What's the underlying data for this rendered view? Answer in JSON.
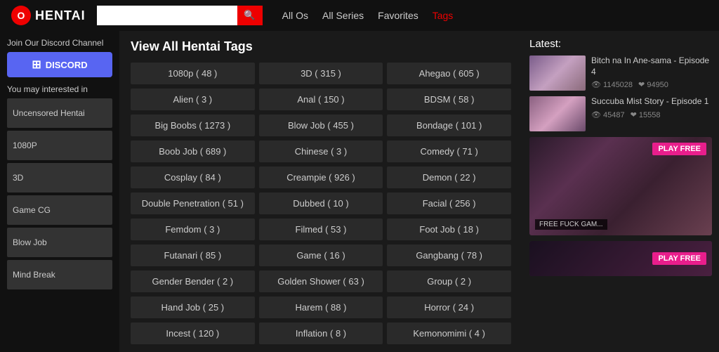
{
  "header": {
    "logo_letter": "O",
    "logo_name": "HENTAI",
    "search_placeholder": "",
    "nav_items": [
      {
        "label": "All Os",
        "active": false
      },
      {
        "label": "All Series",
        "active": false
      },
      {
        "label": "Favorites",
        "active": false
      },
      {
        "label": "Tags",
        "active": true
      }
    ]
  },
  "sidebar": {
    "discord_title": "Join Our Discord Channel",
    "discord_label": "DISCORD",
    "interest_title": "You may interested in",
    "items": [
      {
        "label": "Uncensored Hentai"
      },
      {
        "label": "1080P"
      },
      {
        "label": "3D"
      },
      {
        "label": "Game CG"
      },
      {
        "label": "Blow Job"
      },
      {
        "label": "Mind Break"
      }
    ]
  },
  "content": {
    "heading": "View All Hentai Tags",
    "tags": [
      {
        "label": "1080p ( 48 )"
      },
      {
        "label": "3D ( 315 )"
      },
      {
        "label": "Ahegao ( 605 )"
      },
      {
        "label": "Alien ( 3 )"
      },
      {
        "label": "Anal ( 150 )"
      },
      {
        "label": "BDSM ( 58 )"
      },
      {
        "label": "Big Boobs ( 1273 )"
      },
      {
        "label": "Blow Job ( 455 )"
      },
      {
        "label": "Bondage ( 101 )"
      },
      {
        "label": "Boob Job ( 689 )"
      },
      {
        "label": "Chinese ( 3 )"
      },
      {
        "label": "Comedy ( 71 )"
      },
      {
        "label": "Cosplay ( 84 )"
      },
      {
        "label": "Creampie ( 926 )"
      },
      {
        "label": "Demon ( 22 )"
      },
      {
        "label": "Double Penetration ( 51 )"
      },
      {
        "label": "Dubbed ( 10 )"
      },
      {
        "label": "Facial ( 256 )"
      },
      {
        "label": "Femdom ( 3 )"
      },
      {
        "label": "Filmed ( 53 )"
      },
      {
        "label": "Foot Job ( 18 )"
      },
      {
        "label": "Futanari ( 85 )"
      },
      {
        "label": "Game ( 16 )"
      },
      {
        "label": "Gangbang ( 78 )"
      },
      {
        "label": "Gender Bender ( 2 )"
      },
      {
        "label": "Golden Shower ( 63 )"
      },
      {
        "label": "Group ( 2 )"
      },
      {
        "label": "Hand Job ( 25 )"
      },
      {
        "label": "Harem ( 88 )"
      },
      {
        "label": "Horror ( 24 )"
      },
      {
        "label": "Incest ( 120 )"
      },
      {
        "label": "Inflation ( 8 )"
      },
      {
        "label": "Kemonomimi ( 4 )"
      }
    ]
  },
  "right_panel": {
    "latest_title": "Latest:",
    "items": [
      {
        "title": "Bitch na In Ane-sama - Episode 4",
        "views": "1145028",
        "likes": "94950"
      },
      {
        "title": "Succuba Mist Story - Episode 1",
        "views": "45487",
        "likes": "15558"
      }
    ],
    "ad1": {
      "play_free": "PLAY FREE",
      "label": "FREE FUCK GAM..."
    },
    "ad2": {
      "play_free": "PLAY FREE"
    }
  }
}
